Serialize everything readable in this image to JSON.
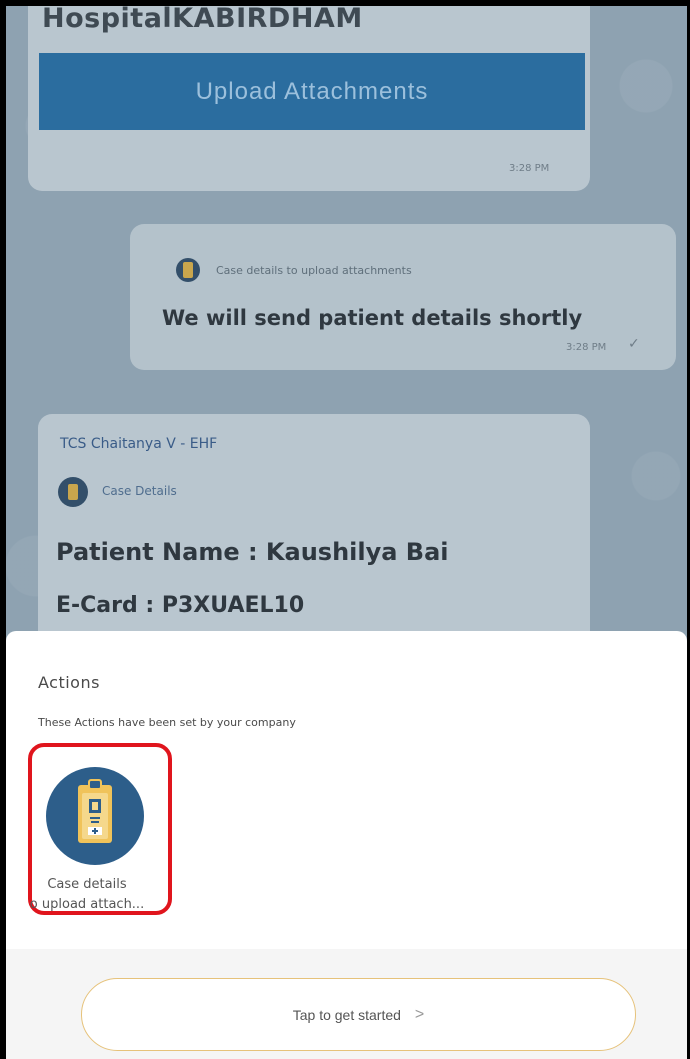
{
  "chat": {
    "top_message": {
      "partial_text": "HospitalKABIRDHAM",
      "button_label": "Upload Attachments",
      "time": "3:28 PM"
    },
    "reply_message": {
      "quoted_ref": "Case details to upload attachments",
      "text": "We will send patient details shortly",
      "time": "3:28 PM",
      "status_icon": "✓"
    },
    "case_message": {
      "sender": "TCS Chaitanya V - EHF",
      "quoted_ref": "Case Details",
      "patient_line": "Patient Name : Kaushilya Bai",
      "ecard_line": "E-Card : P3XUAEL10"
    }
  },
  "sheet": {
    "title": "Actions",
    "subtitle": "These Actions have been set by your company",
    "actions": [
      {
        "label_line1": "Case details",
        "label_line2": "o upload attach...",
        "icon": "id-card-icon"
      }
    ],
    "start_button_label": "Tap to get started",
    "start_chevron": ">"
  },
  "colors": {
    "primary": "#2b6d9f",
    "highlight_border": "#e0151d",
    "start_button_border": "#e6c27a"
  }
}
